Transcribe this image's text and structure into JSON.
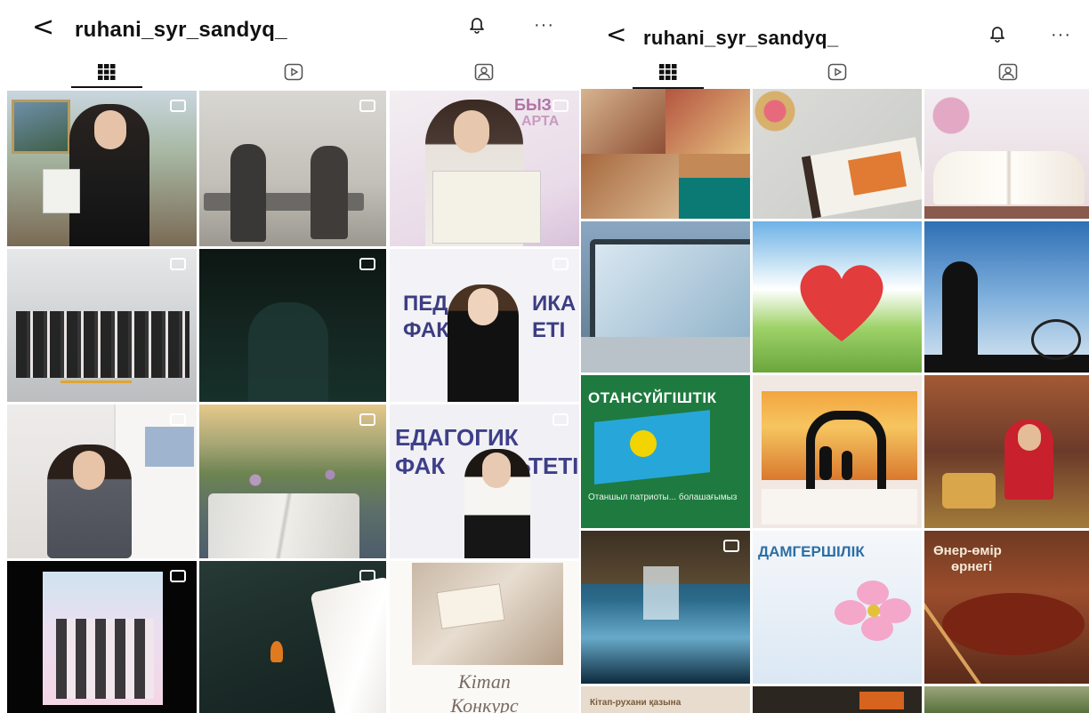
{
  "left_screen": {
    "username": "ruhani_syr_sandyq_",
    "back_glyph": "<",
    "more_glyph": "···",
    "icons": {
      "back": "chevron-left-icon",
      "bell": "bell-icon",
      "more": "more-icon",
      "grid": "grid-icon",
      "reels": "reels-icon",
      "tagged": "tagged-icon"
    },
    "tile_texts": {
      "poster_a": "БЫЗ",
      "poster_b": "АРТА",
      "ped1_a": "ПЕД",
      "ped1_b": "ИКА",
      "ped1_c": "ФАК",
      "ped1_d": "ЕТІ",
      "ped2_a": "ЕДАГОГИК",
      "ped2_b": "ФАК",
      "ped2_c": "ЬТЕТІ",
      "book_caption_1": "Кітап",
      "book_caption_2": "Конкурс"
    }
  },
  "right_screen": {
    "username": "ruhani_syr_sandyq_",
    "back_glyph": "<",
    "more_glyph": "···",
    "icons": {
      "back": "chevron-left-icon",
      "bell": "bell-icon",
      "more": "more-icon",
      "grid": "grid-icon",
      "reels": "reels-icon",
      "tagged": "tagged-icon"
    },
    "tile_texts": {
      "patriot_title": "ОТАНСҮЙГІШТІК",
      "patriot_body": "Отаншыл патриоты... болашағымыз",
      "care_title": "ДАМГЕРШІЛІК",
      "art_title_1": "Өнер-өмір",
      "art_title_2": "өрнегі",
      "book_label": "Кітап-рухани қазына"
    }
  },
  "colors": {
    "text": "#111111",
    "tab_active": "#111111",
    "tab_inactive": "#666666"
  }
}
